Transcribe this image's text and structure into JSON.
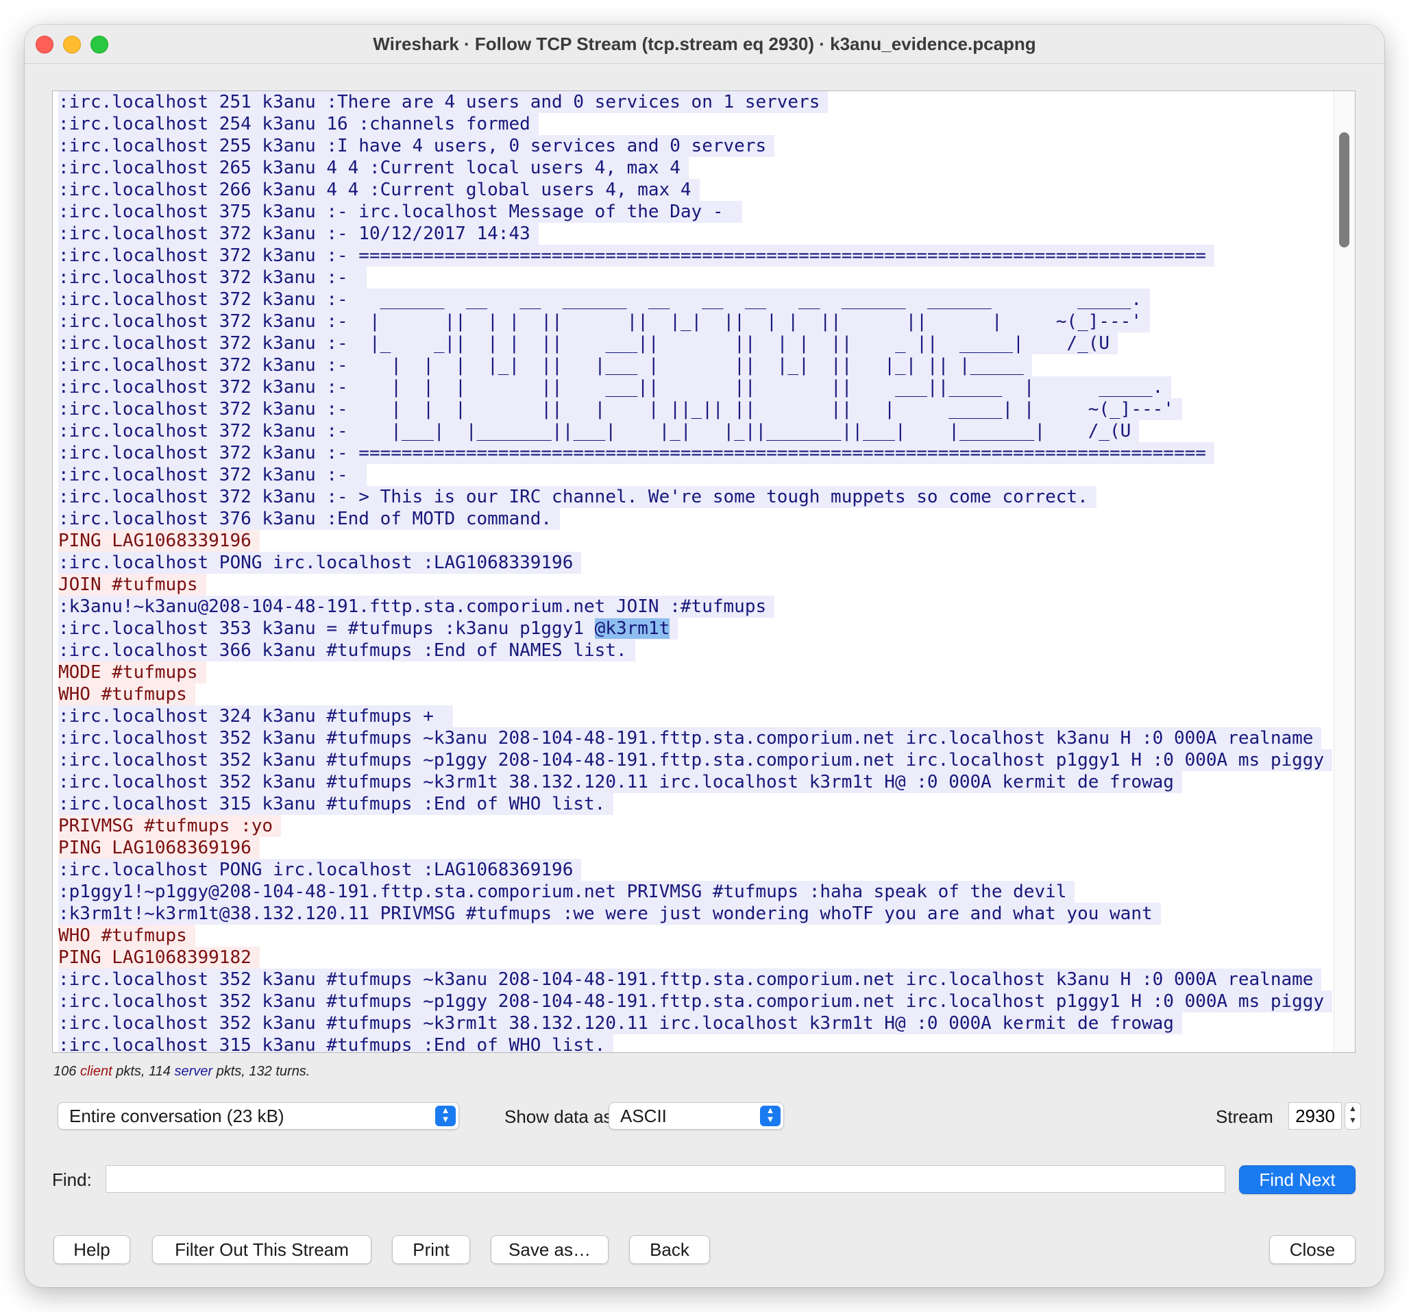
{
  "window": {
    "title": "Wireshark · Follow TCP Stream (tcp.stream eq 2930) · k3anu_evidence.pcapng"
  },
  "stream": {
    "lines": [
      {
        "side": "server",
        "text": ":irc.localhost 251 k3anu :There are 4 users and 0 services on 1 servers"
      },
      {
        "side": "server",
        "text": ":irc.localhost 254 k3anu 16 :channels formed"
      },
      {
        "side": "server",
        "text": ":irc.localhost 255 k3anu :I have 4 users, 0 services and 0 servers"
      },
      {
        "side": "server",
        "text": ":irc.localhost 265 k3anu 4 4 :Current local users 4, max 4"
      },
      {
        "side": "server",
        "text": ":irc.localhost 266 k3anu 4 4 :Current global users 4, max 4"
      },
      {
        "side": "server",
        "text": ":irc.localhost 375 k3anu :- irc.localhost Message of the Day - "
      },
      {
        "side": "server",
        "text": ":irc.localhost 372 k3anu :- 10/12/2017 14:43"
      },
      {
        "side": "server",
        "text": ":irc.localhost 372 k3anu :- ==============================================================================="
      },
      {
        "side": "server",
        "text": ":irc.localhost 372 k3anu :- "
      },
      {
        "side": "server",
        "text": ":irc.localhost 372 k3anu :-   ______  __   __  ______  __   __  __   __  ______  ______        _____."
      },
      {
        "side": "server",
        "text": ":irc.localhost 372 k3anu :-  |      ||  | |  ||      ||  |_|  ||  | |  ||      ||      |     ~(_]---'"
      },
      {
        "side": "server",
        "text": ":irc.localhost 372 k3anu :-  |_    _||  | |  ||    ___||       ||  | |  ||    _ ||  _____|    /_(U"
      },
      {
        "side": "server",
        "text": ":irc.localhost 372 k3anu :-    |  |  |  |_|  ||   |___ |       ||  |_|  ||   |_| || |_____"
      },
      {
        "side": "server",
        "text": ":irc.localhost 372 k3anu :-    |  |  |       ||    ___||       ||       ||    ___||_____  |      _____."
      },
      {
        "side": "server",
        "text": ":irc.localhost 372 k3anu :-    |  |  |       ||   |    | ||_|| ||       ||   |     _____| |     ~(_]---'"
      },
      {
        "side": "server",
        "text": ":irc.localhost 372 k3anu :-    |___|  |_______||___|    |_|   |_||_______||___|    |_______|    /_(U"
      },
      {
        "side": "server",
        "text": ":irc.localhost 372 k3anu :- ==============================================================================="
      },
      {
        "side": "server",
        "text": ":irc.localhost 372 k3anu :- "
      },
      {
        "side": "server",
        "text": ":irc.localhost 372 k3anu :- > This is our IRC channel. We're some tough muppets so come correct."
      },
      {
        "side": "server",
        "text": ":irc.localhost 376 k3anu :End of MOTD command."
      },
      {
        "side": "client",
        "text": "PING LAG1068339196"
      },
      {
        "side": "server",
        "text": ":irc.localhost PONG irc.localhost :LAG1068339196"
      },
      {
        "side": "client",
        "text": "JOIN #tufmups"
      },
      {
        "side": "server",
        "text": ":k3anu!~k3anu@208-104-48-191.fttp.sta.comporium.net JOIN :#tufmups"
      },
      {
        "side": "server",
        "text": ":irc.localhost 353 k3anu = #tufmups :k3anu p1ggy1 ",
        "highlight": "@k3rm1t"
      },
      {
        "side": "server",
        "text": ":irc.localhost 366 k3anu #tufmups :End of NAMES list."
      },
      {
        "side": "client",
        "text": "MODE #tufmups"
      },
      {
        "side": "client",
        "text": "WHO #tufmups"
      },
      {
        "side": "server",
        "text": ":irc.localhost 324 k3anu #tufmups + "
      },
      {
        "side": "server",
        "text": ":irc.localhost 352 k3anu #tufmups ~k3anu 208-104-48-191.fttp.sta.comporium.net irc.localhost k3anu H :0 000A realname"
      },
      {
        "side": "server",
        "text": ":irc.localhost 352 k3anu #tufmups ~p1ggy 208-104-48-191.fttp.sta.comporium.net irc.localhost p1ggy1 H :0 000A ms piggy"
      },
      {
        "side": "server",
        "text": ":irc.localhost 352 k3anu #tufmups ~k3rm1t 38.132.120.11 irc.localhost k3rm1t H@ :0 000A kermit de frowag"
      },
      {
        "side": "server",
        "text": ":irc.localhost 315 k3anu #tufmups :End of WHO list."
      },
      {
        "side": "client",
        "text": "PRIVMSG #tufmups :yo"
      },
      {
        "side": "client",
        "text": "PING LAG1068369196"
      },
      {
        "side": "server",
        "text": ":irc.localhost PONG irc.localhost :LAG1068369196"
      },
      {
        "side": "server",
        "text": ":p1ggy1!~p1ggy@208-104-48-191.fttp.sta.comporium.net PRIVMSG #tufmups :haha speak of the devil"
      },
      {
        "side": "server",
        "text": ":k3rm1t!~k3rm1t@38.132.120.11 PRIVMSG #tufmups :we were just wondering whoTF you are and what you want"
      },
      {
        "side": "client",
        "text": "WHO #tufmups"
      },
      {
        "side": "client",
        "text": "PING LAG1068399182"
      },
      {
        "side": "server",
        "text": ":irc.localhost 352 k3anu #tufmups ~k3anu 208-104-48-191.fttp.sta.comporium.net irc.localhost k3anu H :0 000A realname"
      },
      {
        "side": "server",
        "text": ":irc.localhost 352 k3anu #tufmups ~p1ggy 208-104-48-191.fttp.sta.comporium.net irc.localhost p1ggy1 H :0 000A ms piggy"
      },
      {
        "side": "server",
        "text": ":irc.localhost 352 k3anu #tufmups ~k3rm1t 38.132.120.11 irc.localhost k3rm1t H@ :0 000A kermit de frowag"
      },
      {
        "side": "server",
        "text": ":irc.localhost 315 k3anu #tufmups :End of WHO list."
      }
    ]
  },
  "stats": {
    "client_pkts": "106",
    "client_word": "client",
    "pkts_word": "pkts,",
    "server_pkts": "114",
    "server_word": "server",
    "turns": "132 turns."
  },
  "controls": {
    "conversation_select": "Entire conversation (23 kB)",
    "show_data_label": "Show data as",
    "show_data_select": "ASCII",
    "stream_label": "Stream",
    "stream_value": "2930",
    "find_label": "Find:",
    "find_value": "",
    "find_next": "Find Next"
  },
  "buttons": {
    "help": "Help",
    "filter_out": "Filter Out This Stream",
    "print": "Print",
    "save_as": "Save as…",
    "back": "Back",
    "close": "Close"
  },
  "colors": {
    "server_bg": "#ececfb",
    "server_fg": "#17187a",
    "client_bg": "#fcecec",
    "client_fg": "#7b1010",
    "highlight": "#8fbff0",
    "accent": "#1a7af0"
  }
}
